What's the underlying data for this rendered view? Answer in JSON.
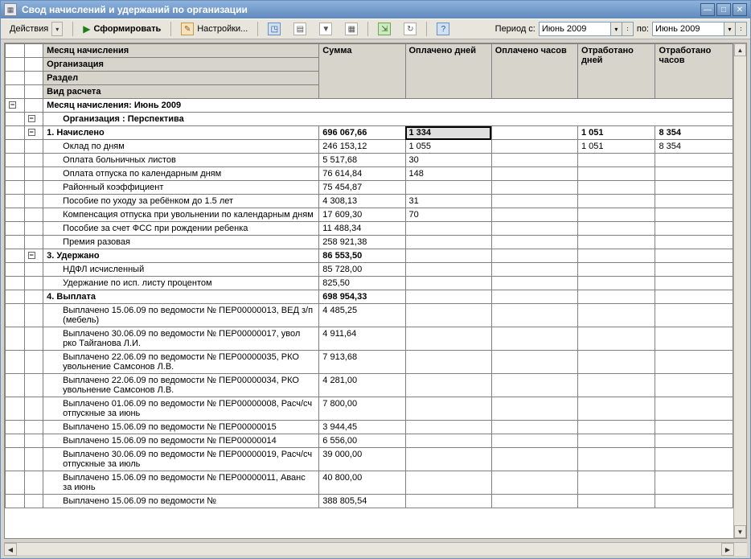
{
  "window": {
    "title": "Свод начислений и удержаний по организации"
  },
  "toolbar": {
    "actions": "Действия",
    "form": "Сформировать",
    "settings": "Настройки..."
  },
  "period": {
    "label_from": "Период с:",
    "from": "Июнь 2009",
    "label_to": "по:",
    "to": "Июнь 2009"
  },
  "headers": {
    "month": "Месяц начисления",
    "org": "Организация",
    "section": "Раздел",
    "calc_type": "Вид расчета",
    "sum": "Сумма",
    "paid_days": "Оплачено дней",
    "paid_hours": "Оплачено часов",
    "worked_days": "Отработано дней",
    "worked_hours": "Отработано часов"
  },
  "groups": {
    "month": "Месяц начисления: Июнь 2009",
    "org": "Организация : Перспектива",
    "accrued": "1. Начислено",
    "withheld": "3. Удержано",
    "payout": "4. Выплата"
  },
  "rows": {
    "accrued_total": {
      "sum": "696 067,66",
      "pd": "1 334",
      "wd": "1 051",
      "wh": "8 354"
    },
    "accrued": [
      {
        "name": "Оклад по дням",
        "sum": "246 153,12",
        "pd": "1 055",
        "wd": "1 051",
        "wh": "8 354"
      },
      {
        "name": "Оплата больничных листов",
        "sum": "5 517,68",
        "pd": "30"
      },
      {
        "name": "Оплата отпуска по календарным дням",
        "sum": "76 614,84",
        "pd": "148"
      },
      {
        "name": "Районный коэффициент",
        "sum": "75 454,87"
      },
      {
        "name": "Пособие по уходу за ребёнком до 1.5 лет",
        "sum": "4 308,13",
        "pd": "31"
      },
      {
        "name": "Компенсация отпуска при увольнении по календарным дням",
        "sum": "17 609,30",
        "pd": "70"
      },
      {
        "name": "Пособие за счет ФСС при рождении ребенка",
        "sum": "11 488,34"
      },
      {
        "name": "Премия разовая",
        "sum": "258 921,38"
      }
    ],
    "withheld_total": {
      "sum": "86 553,50"
    },
    "withheld": [
      {
        "name": "НДФЛ исчисленный",
        "sum": "85 728,00"
      },
      {
        "name": "Удержание по исп. листу процентом",
        "sum": "825,50"
      }
    ],
    "payout_total": {
      "sum": "698 954,33"
    },
    "payout": [
      {
        "name": "Выплачено 15.06.09 по ведомости № ПЕР00000013, ВЕД з/п (мебель)",
        "sum": "4 485,25"
      },
      {
        "name": "Выплачено 30.06.09 по ведомости № ПЕР00000017, увол ркo Тайганова Л.И.",
        "sum": "4 911,64"
      },
      {
        "name": "Выплачено 22.06.09 по ведомости № ПЕР00000035, РКО увольнение Самсонов Л.В.",
        "sum": "7 913,68"
      },
      {
        "name": "Выплачено 22.06.09 по ведомости № ПЕР00000034, РКО увольнение Самсонов Л.В.",
        "sum": "4 281,00"
      },
      {
        "name": "Выплачено 01.06.09 по ведомости № ПЕР00000008, Расч/сч отпускные за июнь",
        "sum": "7 800,00"
      },
      {
        "name": "Выплачено 15.06.09 по ведомости № ПЕР00000015",
        "sum": "3 944,45"
      },
      {
        "name": "Выплачено 15.06.09 по ведомости № ПЕР00000014",
        "sum": "6 556,00"
      },
      {
        "name": "Выплачено 30.06.09 по ведомости № ПЕР00000019, Расч/сч отпускные за июль",
        "sum": "39 000,00"
      },
      {
        "name": "Выплачено 15.06.09 по ведомости № ПЕР00000011, Аванс за июнь",
        "sum": "40 800,00"
      },
      {
        "name": "Выплачено 15.06.09 по ведомости №",
        "sum": "388 805,54"
      }
    ]
  }
}
